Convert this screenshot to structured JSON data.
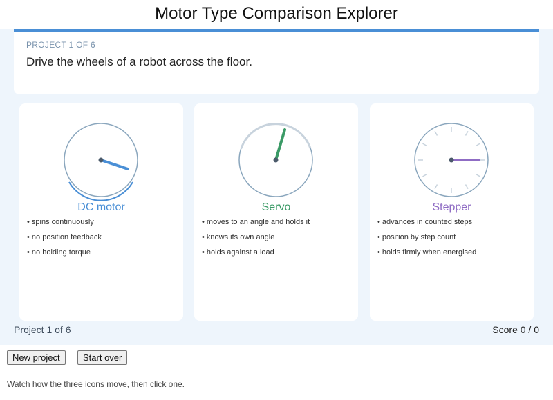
{
  "page": {
    "title": "Motor Type Comparison Explorer"
  },
  "prompt": {
    "progress_label": "PROJECT 1 OF 6",
    "task": "Drive the wheels of a robot across the floor."
  },
  "motors": [
    {
      "name": "DC motor",
      "color": "#4a8fd6",
      "icon": "dc-motor-dial-icon",
      "features": [
        "spins continuously",
        "no position feedback",
        "no holding torque"
      ]
    },
    {
      "name": "Servo",
      "color": "#3a9a66",
      "icon": "servo-dial-icon",
      "features": [
        "moves to an angle and holds it",
        "knows its own angle",
        "holds against a load"
      ]
    },
    {
      "name": "Stepper",
      "color": "#8f6cc4",
      "icon": "stepper-dial-icon",
      "features": [
        "advances in counted steps",
        "position by step count",
        "holds firmly when energised"
      ]
    }
  ],
  "status": {
    "progress": "Project 1 of 6",
    "score": "Score 0 / 0"
  },
  "controls": {
    "new_project": "New project",
    "start_over": "Start over"
  },
  "hint": "Watch how the three icons move, then click one."
}
